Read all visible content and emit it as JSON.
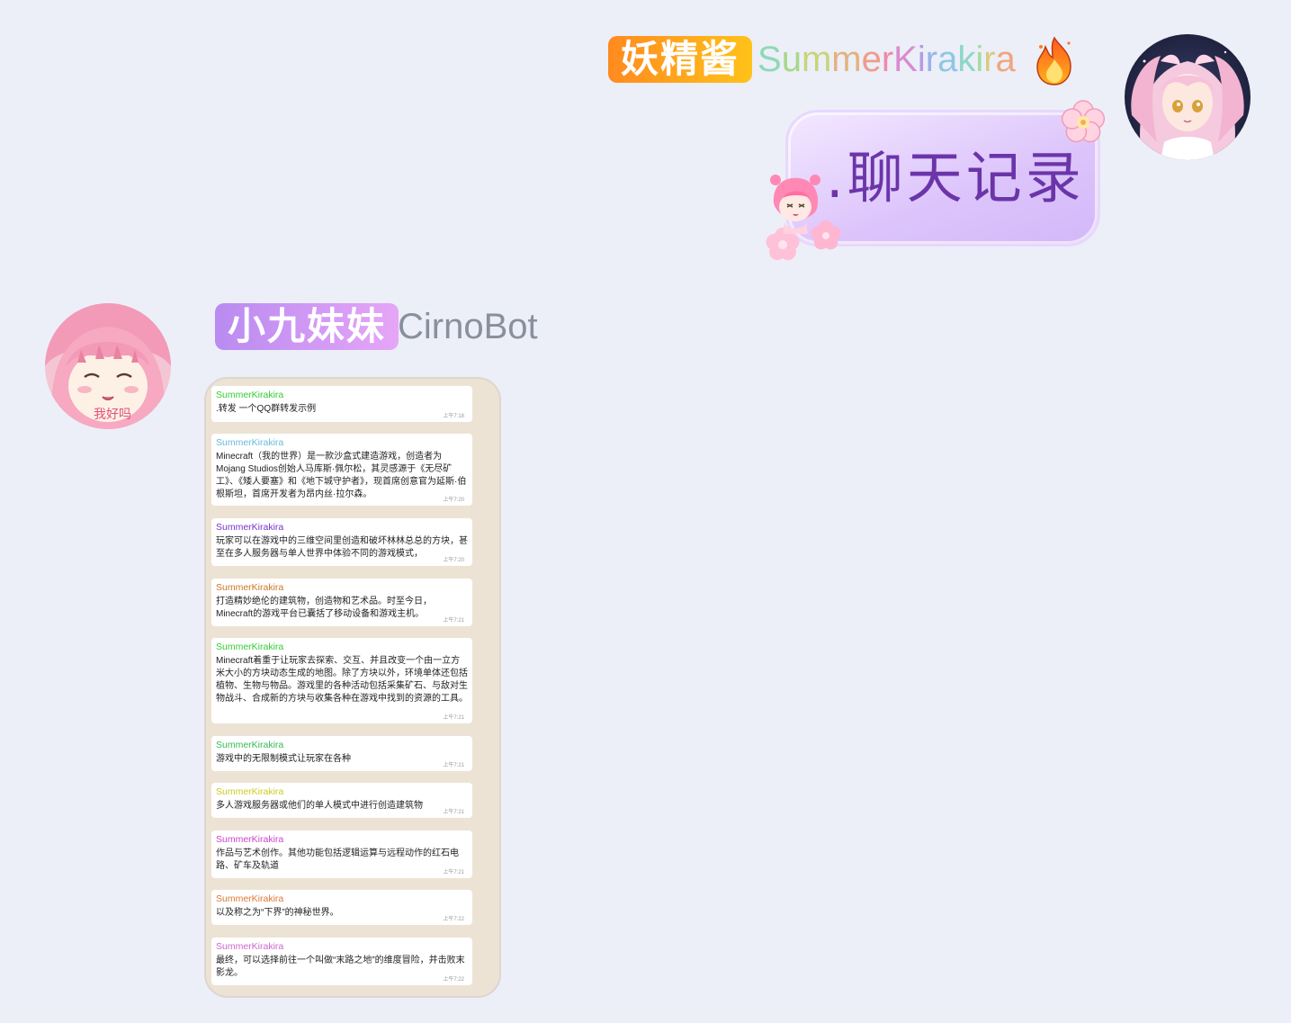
{
  "user": {
    "title_badge": "妖精酱",
    "nickname_chars": [
      "S",
      "u",
      "m",
      "m",
      "e",
      "r",
      "K",
      "i",
      "r",
      "a",
      "k",
      "i",
      "r",
      "a"
    ],
    "sent_message": ".聊天记录"
  },
  "bot": {
    "title_badge": "小九妹妹",
    "nickname": "CirnoBot",
    "avatar_caption": "我好吗"
  },
  "record": {
    "messages": [
      {
        "name": "SummerKirakira",
        "color": "#33cc33",
        "text": ".转发 一个QQ群转发示例",
        "time": "上午7:18"
      },
      {
        "name": "SummerKirakira",
        "color": "#66bbdd",
        "text": "Minecraft（我的世界）是一款沙盒式建造游戏，创造者为Mojang Studios创始人马库斯·佩尔松，其灵感源于《无尽矿工》、《矮人要塞》和《地下城守护者》，现首席创意官为延斯·伯根斯坦，首席开发者为昂内丝·拉尔森。",
        "time": "上午7:20"
      },
      {
        "name": "SummerKirakira",
        "color": "#7733cc",
        "text": "玩家可以在游戏中的三维空间里创造和破坏林林总总的方块，甚至在多人服务器与单人世界中体验不同的游戏模式，",
        "time": "上午7:20"
      },
      {
        "name": "SummerKirakira",
        "color": "#cc7722",
        "text": "打造精妙绝伦的建筑物，创造物和艺术品。时至今日，Minecraft的游戏平台已囊括了移动设备和游戏主机。",
        "time": "上午7:21"
      },
      {
        "name": "SummerKirakira",
        "color": "#33cc33",
        "text": "Minecraft着重于让玩家去探索、交互、并且改变一个由一立方米大小的方块动态生成的地图。除了方块以外，环境单体还包括植物、生物与物品。游戏里的各种活动包括采集矿石、与敌对生物战斗、合成新的方块与收集各种在游戏中找到的资源的工具。",
        "time": "上午7:21"
      },
      {
        "name": "SummerKirakira",
        "color": "#33bb55",
        "text": "游戏中的无限制模式让玩家在各种",
        "time": "上午7:21"
      },
      {
        "name": "SummerKirakira",
        "color": "#cccc22",
        "text": "多人游戏服务器或他们的单人模式中进行创造建筑物",
        "time": "上午7:21"
      },
      {
        "name": "SummerKirakira",
        "color": "#cc44cc",
        "text": "作品与艺术创作。其他功能包括逻辑运算与远程动作的红石电路、矿车及轨道",
        "time": "上午7:21"
      },
      {
        "name": "SummerKirakira",
        "color": "#dd7733",
        "text": "以及称之为“下界”的神秘世界。",
        "time": "上午7:22"
      },
      {
        "name": "SummerKirakira",
        "color": "#cc66cc",
        "text": "最终，可以选择前往一个叫做“末路之地”的维度冒险，并击败末影龙。",
        "time": "上午7:22"
      }
    ]
  },
  "colors": {
    "background": "#eceff8",
    "user_badge": "#ff9a1f",
    "bot_badge": "#c48ef2",
    "bubble": "#dcc4fb",
    "bubble_text": "#6b35a9",
    "card": "#ede3d4"
  },
  "icons": [
    "fire-icon",
    "flower-icon",
    "pink-girl-sticker-icon",
    "user-avatar",
    "bot-avatar"
  ]
}
